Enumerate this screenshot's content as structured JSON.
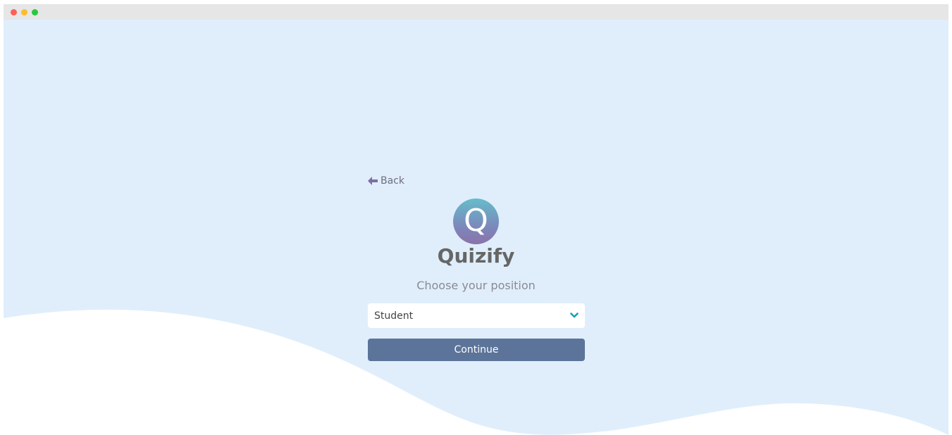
{
  "window": {
    "controls": [
      "close",
      "minimize",
      "zoom"
    ]
  },
  "nav": {
    "back_label": "Back",
    "back_icon": "arrow-left-icon"
  },
  "brand": {
    "logo_letter": "Q",
    "name": "Quizify"
  },
  "form": {
    "prompt": "Choose your position",
    "position_select": {
      "selected": "Student",
      "icon": "chevron-down-icon"
    },
    "continue_label": "Continue"
  },
  "colors": {
    "background": "#e0eefc",
    "wave": "#ffffff",
    "back_icon": "#7d6fa3",
    "chevron": "#16a3b5",
    "button": "#5c7499",
    "brand_text": "#666666",
    "logo_gradient_top": "#66bccb",
    "logo_gradient_bottom": "#8b72a8"
  }
}
